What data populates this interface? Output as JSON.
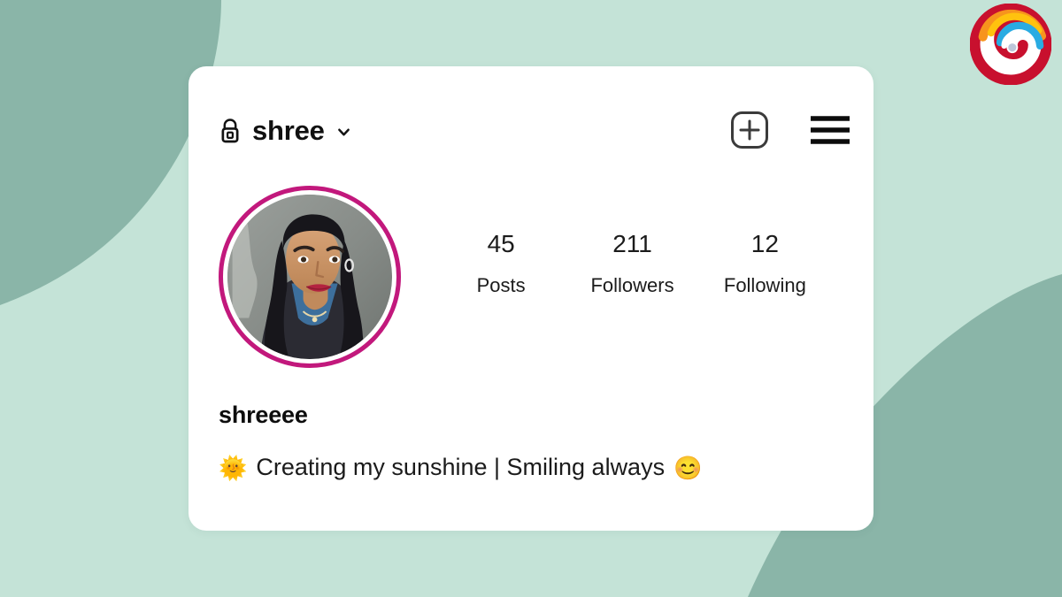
{
  "theme": {
    "background_light": "#c4e3d7",
    "background_dark": "#8ab5a8",
    "card_background": "#ffffff",
    "avatar_ring": "#c2187c",
    "text_primary": "#1b1b1b"
  },
  "brand": {
    "logo_name": "spiral-swirl-logo",
    "logo_colors": [
      "#c8102e",
      "#e8472b",
      "#f7941d",
      "#ffc20e",
      "#29abe2",
      "#ffffff"
    ]
  },
  "card": {
    "header": {
      "privacy_icon": "lock-icon",
      "handle": "shree",
      "chevron_icon": "chevron-down-icon",
      "add_icon": "plus-square-icon",
      "menu_icon": "hamburger-menu-icon"
    },
    "avatar": {
      "icon_name": "profile-avatar",
      "alt": "profile photo"
    },
    "stats": [
      {
        "value": "45",
        "label": "Posts"
      },
      {
        "value": "211",
        "label": "Followers"
      },
      {
        "value": "12",
        "label": "Following"
      }
    ],
    "bio": {
      "display_name": "shreeee",
      "leading_emoji": "🌞",
      "text": "Creating my sunshine | Smiling always",
      "trailing_emoji": "😊"
    }
  }
}
